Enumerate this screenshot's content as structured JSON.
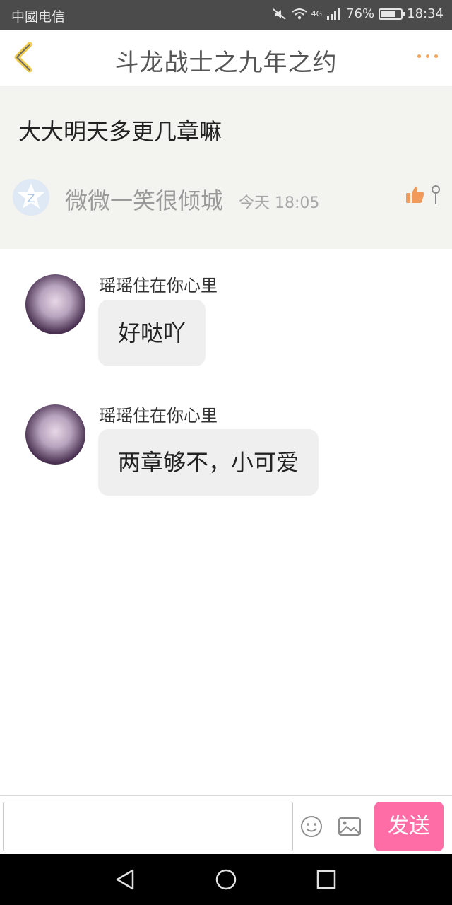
{
  "status_bar": {
    "carrier": "中國电信",
    "battery_text": "76%",
    "battery_level": 0.76,
    "time": "18:34",
    "network_label": "4G"
  },
  "header": {
    "title": "斗龙战士之九年之约",
    "back_icon": "chevron-left-icon",
    "more_icon": "more-dots-icon",
    "accent_color": "#f3a65e"
  },
  "post": {
    "text": "大大明天多更几章嘛",
    "author": "微微一笑很倾城",
    "time": "今天 18:05",
    "like_icon": "thumbs-up-icon",
    "pin_icon": "pin-icon"
  },
  "replies": [
    {
      "name": "瑶瑶住在你心里",
      "message": "好哒吖"
    },
    {
      "name": "瑶瑶住在你心里",
      "message": "两章够不，小可爱"
    }
  ],
  "input_bar": {
    "placeholder": "",
    "emoji_icon": "smiley-icon",
    "image_icon": "image-icon",
    "send_label": "发送",
    "send_color": "#ff6da7"
  },
  "nav_bar": {
    "back_icon": "nav-back-icon",
    "home_icon": "nav-home-icon",
    "recent_icon": "nav-recents-icon"
  }
}
